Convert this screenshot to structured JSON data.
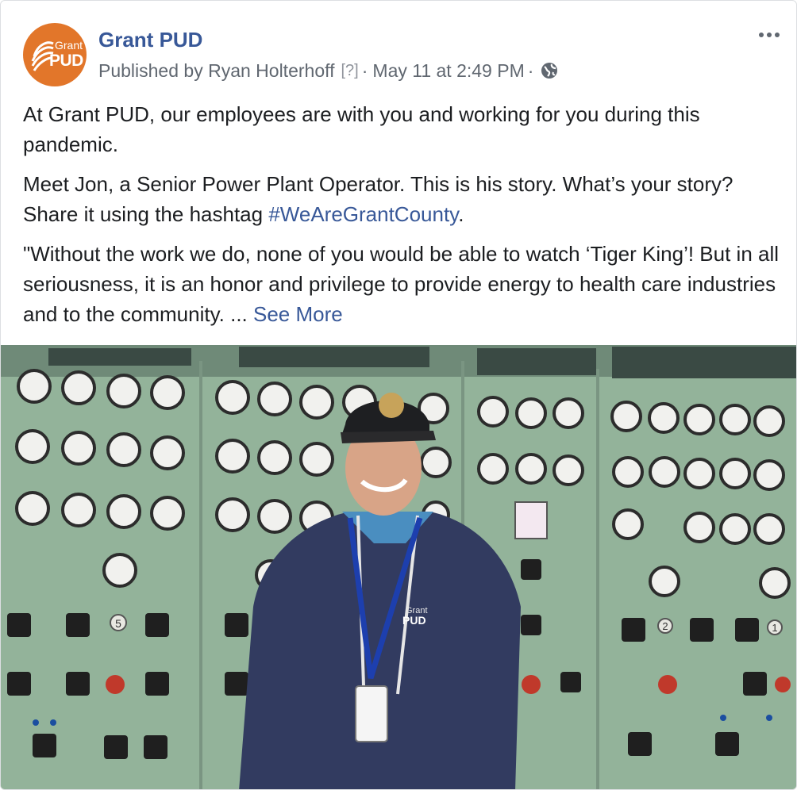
{
  "post": {
    "page_name": "Grant PUD",
    "avatar": {
      "logo_line1": "Grant",
      "logo_line2": "PUD",
      "color": "#e2762a"
    },
    "meta": {
      "published_by": "Published by Ryan Holterhoff",
      "help_marker": "[?]",
      "separator": "·",
      "date": "May 11 at 2:49 PM",
      "separator2": "·",
      "privacy_icon": "globe-icon"
    },
    "more_icon": "more-options-icon",
    "paragraphs": {
      "p1": "At Grant PUD, our employees are with you and working for you during this pandemic.",
      "p2_text": "Meet Jon, a Senior Power Plant Operator. This is his story. What’s your story? Share it using the hashtag ",
      "p2_hashtag": "#WeAreGrantCounty",
      "p2_end": ".",
      "p3_text": "\"Without the work we do, none of you would be able to watch ‘Tiger King’! But in all seriousness, it is an honor and privilege to provide energy to health care industries and to the community. ... ",
      "p3_see_more": "See More"
    },
    "photo": {
      "hoodie_logo_line1": "Grant",
      "hoodie_logo_line2": "PUD",
      "panel_number_1": "5",
      "panel_number_2": "2",
      "panel_number_3": "1"
    }
  },
  "colors": {
    "link": "#385898",
    "meta": "#606770",
    "panel": "#8fac94"
  }
}
